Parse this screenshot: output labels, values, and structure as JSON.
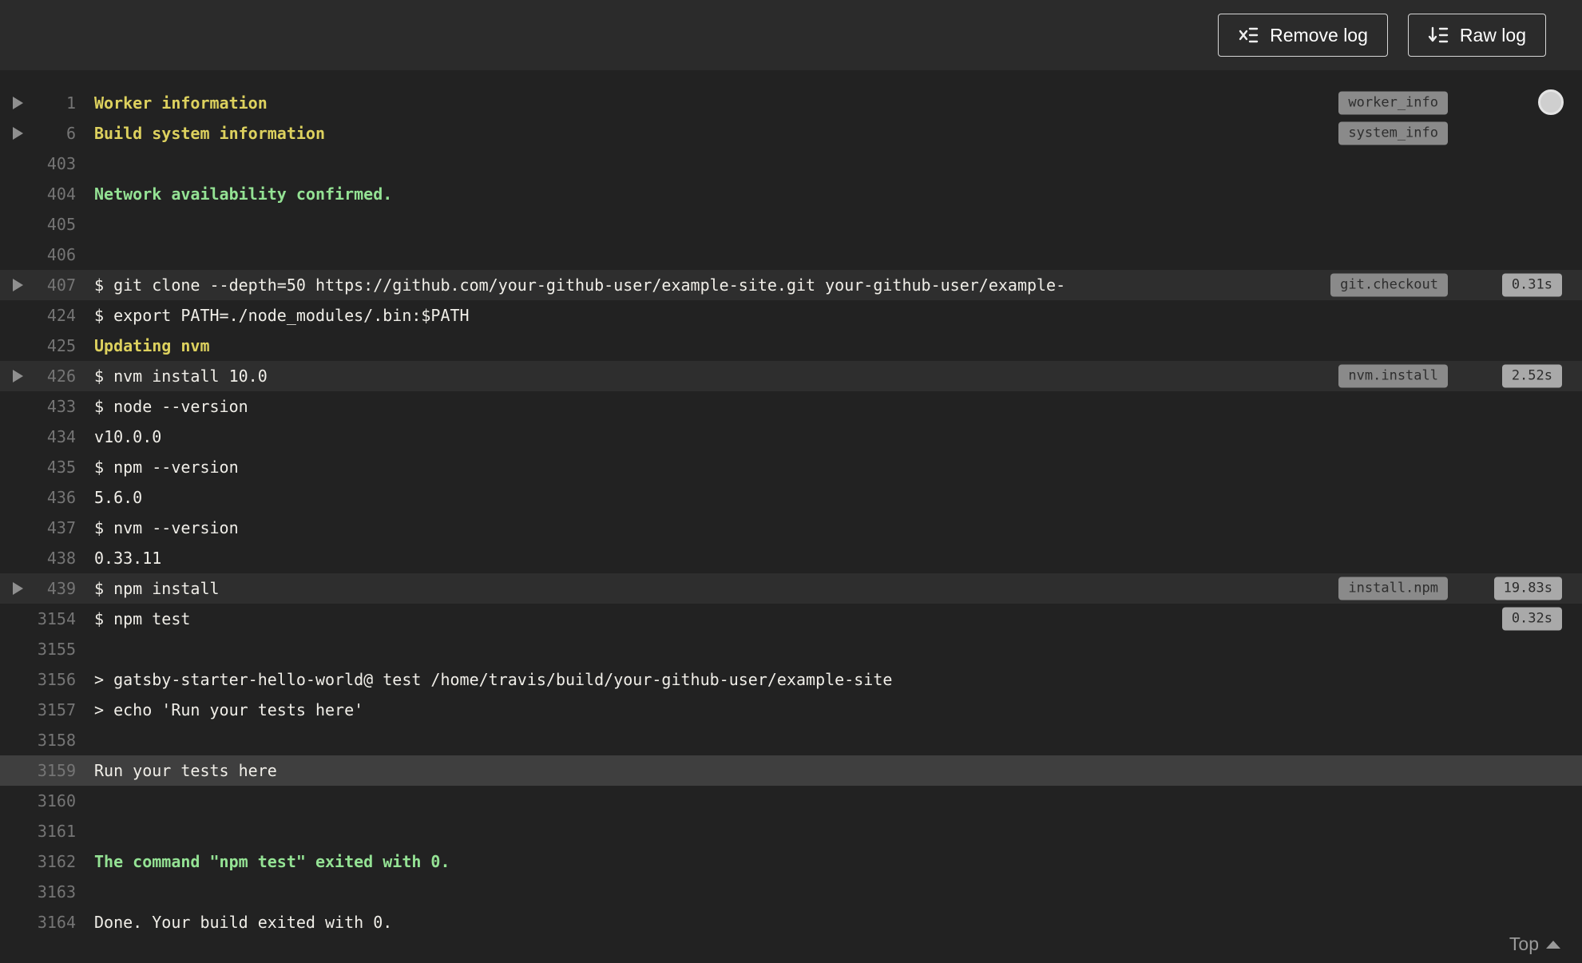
{
  "header": {
    "remove_log_label": "Remove log",
    "raw_log_label": "Raw log",
    "icons": {
      "remove_log": "list-with-x-icon",
      "raw_log": "list-with-down-arrow-icon"
    }
  },
  "colors": {
    "background": "#222222",
    "toolbar_background": "#2b2b2b",
    "fold_row_background": "#2e2e2e",
    "selected_row_background": "#3f3f3f",
    "text": "#f0eee8",
    "line_number": "#757575",
    "yellow": "#ddd15e",
    "green": "#94e294",
    "tag_pill": "#8a8a8a",
    "duration_pill": "#a9a9a9"
  },
  "log": {
    "lines": [
      {
        "number": "1",
        "text": "Worker information",
        "style": "yellow",
        "fold": true,
        "tag": "worker_info"
      },
      {
        "number": "6",
        "text": "Build system information",
        "style": "yellow",
        "fold": true,
        "tag": "system_info"
      },
      {
        "number": "403",
        "text": ""
      },
      {
        "number": "404",
        "text": "Network availability confirmed.",
        "style": "green"
      },
      {
        "number": "405",
        "text": ""
      },
      {
        "number": "406",
        "text": ""
      },
      {
        "number": "407",
        "text": "$ git clone --depth=50 https://github.com/your-github-user/example-site.git your-github-user/example-",
        "fold": true,
        "tag": "git.checkout",
        "duration": "0.31s",
        "highlight": "row"
      },
      {
        "number": "424",
        "text": "$ export PATH=./node_modules/.bin:$PATH"
      },
      {
        "number": "425",
        "text": "Updating nvm",
        "style": "yellow"
      },
      {
        "number": "426",
        "text": "$ nvm install 10.0",
        "fold": true,
        "tag": "nvm.install",
        "duration": "2.52s",
        "highlight": "row"
      },
      {
        "number": "433",
        "text": "$ node --version"
      },
      {
        "number": "434",
        "text": "v10.0.0"
      },
      {
        "number": "435",
        "text": "$ npm --version"
      },
      {
        "number": "436",
        "text": "5.6.0"
      },
      {
        "number": "437",
        "text": "$ nvm --version"
      },
      {
        "number": "438",
        "text": "0.33.11"
      },
      {
        "number": "439",
        "text": "$ npm install",
        "fold": true,
        "tag": "install.npm",
        "duration": "19.83s",
        "highlight": "row"
      },
      {
        "number": "3154",
        "text": "$ npm test",
        "duration": "0.32s"
      },
      {
        "number": "3155",
        "text": ""
      },
      {
        "number": "3156",
        "text": "> gatsby-starter-hello-world@ test /home/travis/build/your-github-user/example-site"
      },
      {
        "number": "3157",
        "text": "> echo 'Run your tests here'"
      },
      {
        "number": "3158",
        "text": ""
      },
      {
        "number": "3159",
        "text": "Run your tests here",
        "highlight": "selected"
      },
      {
        "number": "3160",
        "text": ""
      },
      {
        "number": "3161",
        "text": ""
      },
      {
        "number": "3162",
        "text": "The command \"npm test\" exited with 0.",
        "style": "green"
      },
      {
        "number": "3163",
        "text": ""
      },
      {
        "number": "3164",
        "text": "Done. Your build exited with 0."
      }
    ]
  },
  "footer": {
    "top_label": "Top"
  }
}
